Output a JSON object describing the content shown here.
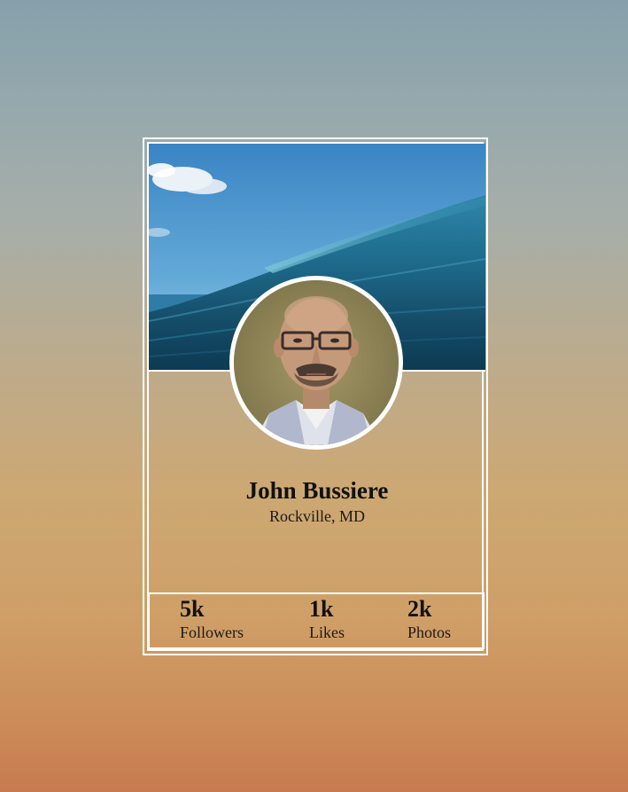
{
  "profile": {
    "name": "John Bussiere",
    "location": "Rockville, MD"
  },
  "stats": {
    "followers": {
      "value": "5k",
      "label": "Followers"
    },
    "likes": {
      "value": "1k",
      "label": "Likes"
    },
    "photos": {
      "value": "2k",
      "label": "Photos"
    }
  },
  "colors": {
    "card_border": "#ffffff",
    "text": "#111111"
  }
}
